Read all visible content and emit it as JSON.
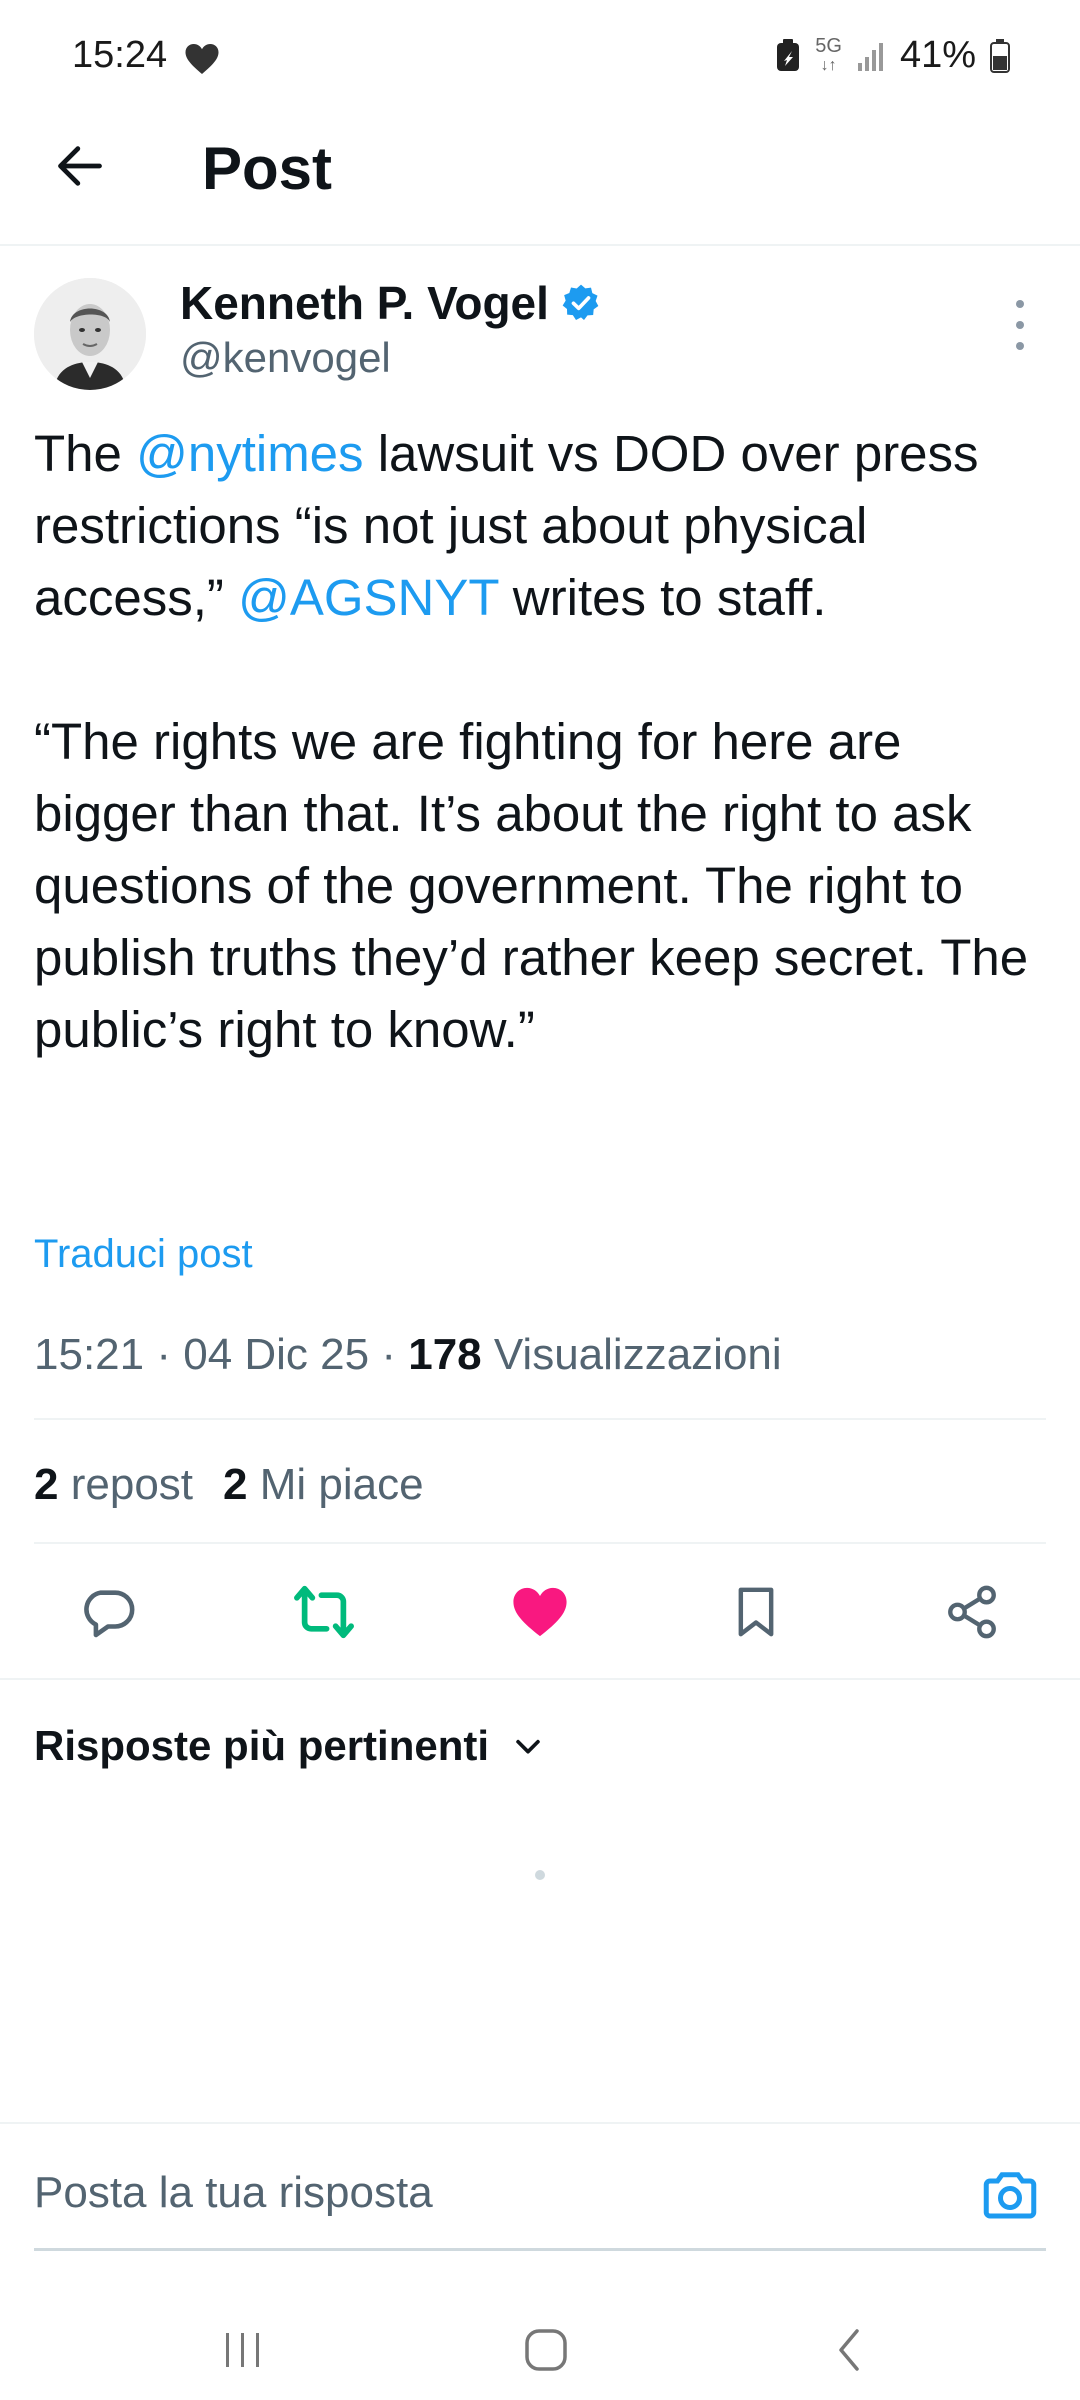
{
  "status_bar": {
    "time": "15:24",
    "network": "5G",
    "battery": "41%",
    "icons": [
      "heart-icon",
      "battery-saver-icon",
      "signal-icon",
      "battery-icon"
    ]
  },
  "header": {
    "title": "Post",
    "back_icon": "arrow-left-icon"
  },
  "author": {
    "name": "Kenneth P. Vogel",
    "handle": "@kenvogel",
    "verified_icon": "verified-badge-icon"
  },
  "tweet": {
    "part1": "The ",
    "mention1": "@nytimes",
    "part2": " lawsuit vs DOD over press restrictions “is not just about physical access,” ",
    "mention2": "@AGSNYT",
    "part3": " writes to staff.\n\n“The rights we are fighting for here are bigger than that. It’s about the right to ask questions of the government. The right to publish truths they’d rather keep secret. The public’s right to know.”"
  },
  "translate_label": "Traduci post",
  "meta": {
    "time": "15:21",
    "date": "04 Dic 25",
    "views_count": "178",
    "views_label": "Visualizzazioni",
    "separator": " · "
  },
  "stats": {
    "reposts_count": "2",
    "reposts_label": "repost",
    "likes_count": "2",
    "likes_label": "Mi piace"
  },
  "actions": [
    {
      "icon": "reply-icon"
    },
    {
      "icon": "repost-icon",
      "color": "#00ba7c"
    },
    {
      "icon": "like-icon",
      "color": "#f91880",
      "active": true
    },
    {
      "icon": "bookmark-icon"
    },
    {
      "icon": "share-icon"
    }
  ],
  "replies_sort": {
    "label": "Risposte più pertinenti",
    "icon": "chevron-down-icon"
  },
  "reply_box": {
    "placeholder": "Posta la tua risposta",
    "icon": "camera-icon",
    "accent": "#1d9bf0"
  },
  "nav_bar": [
    "recent-apps-icon",
    "home-icon",
    "back-icon"
  ]
}
